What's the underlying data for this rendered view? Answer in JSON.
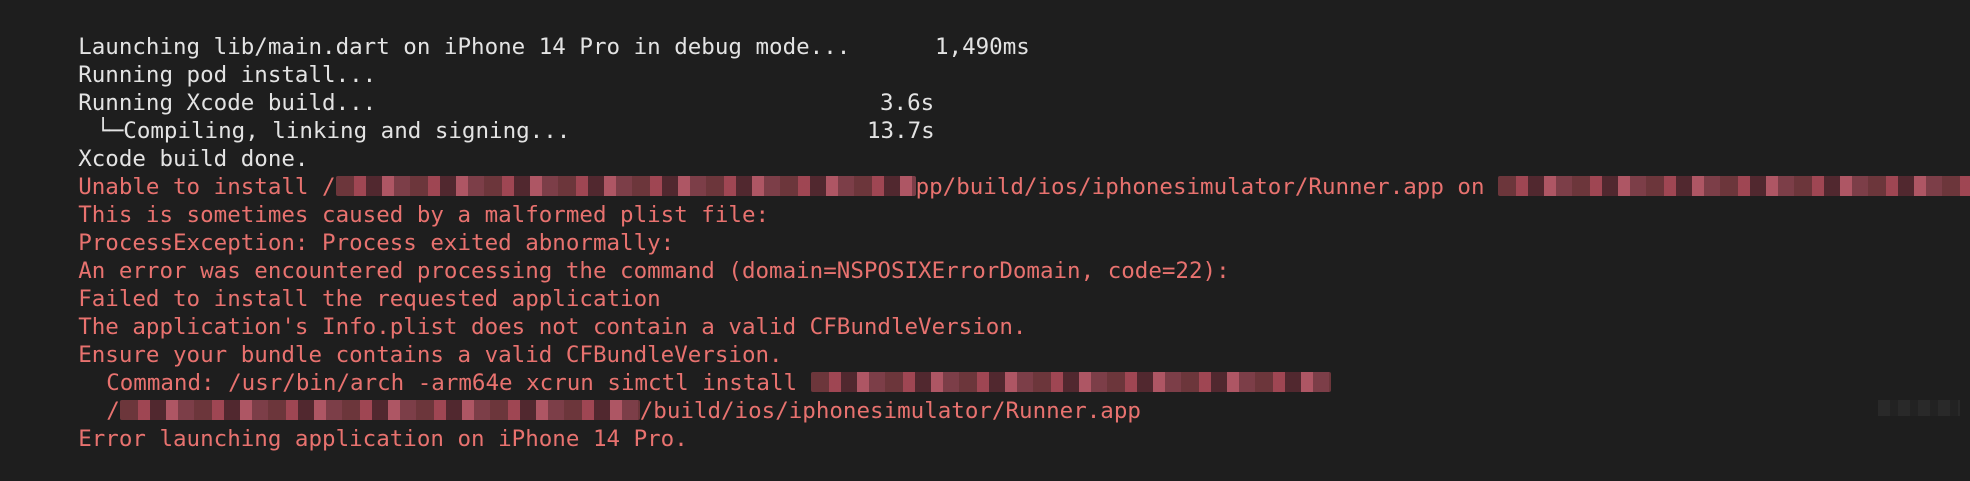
{
  "terminal": {
    "lines": [
      {
        "text": "Launching lib/main.dart on iPhone 14 Pro in debug mode..."
      },
      {
        "text": "Running pod install...",
        "timing": "1,490ms"
      },
      {
        "text": "Running Xcode build..."
      },
      {
        "text": "Compiling, linking and signing...",
        "timing": "3.6s",
        "tree_glyph": "└─"
      },
      {
        "text": "Xcode build done.",
        "timing": "13.7s"
      }
    ],
    "errors": {
      "unable_prefix": "Unable to install /",
      "unable_mid": "pp/build/ios/iphonesimulator/Runner.app on ",
      "plist": "This is sometimes caused by a malformed plist file:",
      "process_exception": "ProcessException: Process exited abnormally:",
      "encountered": "An error was encountered processing the command (domain=NSPOSIXErrorDomain, code=22):",
      "failed_install": "Failed to install the requested application",
      "info_plist": "The application's Info.plist does not contain a valid CFBundleVersion.",
      "ensure": "Ensure your bundle contains a valid CFBundleVersion.",
      "command": "Command: /usr/bin/arch -arm64e xcrun simctl install ",
      "path_prefix": "/",
      "path_suffix": "/build/ios/iphonesimulator/Runner.app",
      "launch_error": "Error launching application on iPhone 14 Pro."
    },
    "colors": {
      "background": "#1e1e1e",
      "normal_text": "#e3e3e3",
      "error_text": "#e8726f"
    }
  }
}
